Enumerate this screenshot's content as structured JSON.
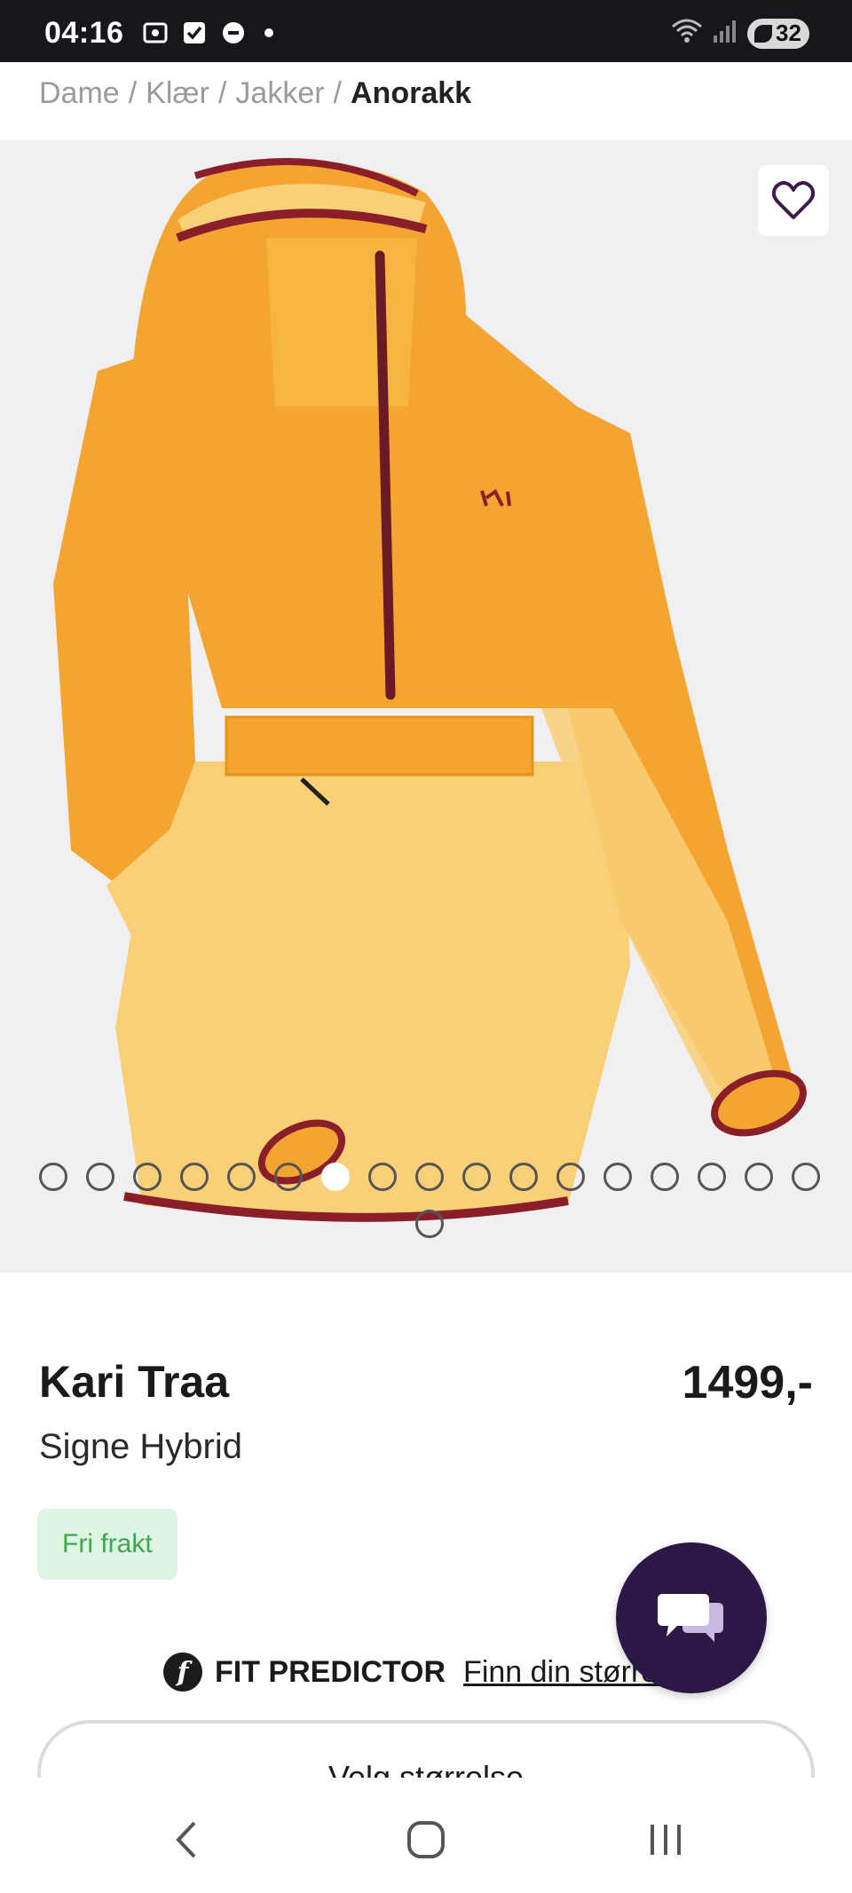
{
  "status_bar": {
    "time": "04:16",
    "battery_level": "32",
    "icons": [
      "screenshot-icon",
      "checkbox-icon",
      "sync-icon",
      "notification-dot",
      "wifi-icon",
      "signal-icon",
      "battery-icon"
    ]
  },
  "breadcrumb": {
    "items": [
      "Dame",
      "Klær",
      "Jakker"
    ],
    "separator": "/",
    "current": "Anorakk"
  },
  "gallery": {
    "image_count": 18,
    "active_index": 6,
    "favorite_icon": "heart-outline-icon",
    "colors": {
      "jacket_main": "#F4A531",
      "jacket_light": "#F9CF78",
      "trim": "#8A1F2A"
    }
  },
  "product": {
    "brand": "Kari Traa",
    "name": "Signe Hybrid",
    "price": "1499,-",
    "badge": "Fri frakt"
  },
  "fit_predictor": {
    "logo_letter": "f",
    "title": "FIT PREDICTOR",
    "link": "Finn din størrelse"
  },
  "size_selector": {
    "label": "Velg størrelse"
  },
  "chat": {
    "icon": "chat-bubbles-icon",
    "color": "#2C1747"
  },
  "nav": {
    "back": "back-icon",
    "home": "home-icon",
    "recents": "recents-icon"
  }
}
